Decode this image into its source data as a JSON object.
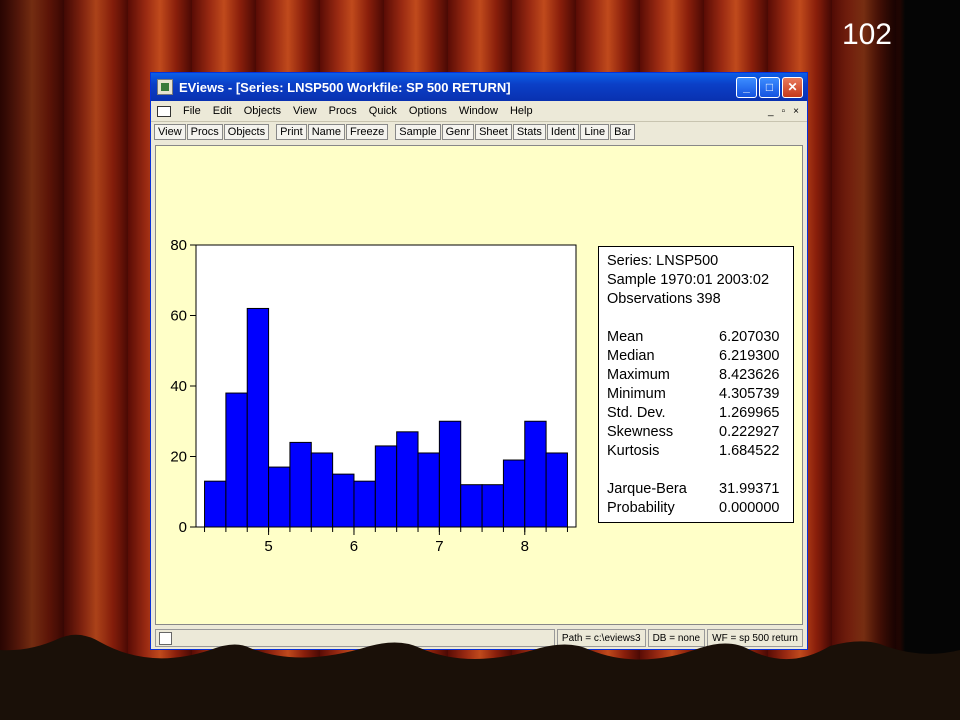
{
  "slide": {
    "number": "102"
  },
  "window": {
    "title": "EViews - [Series: LNSP500   Workfile: SP 500 RETURN]",
    "min_icon": "minimize-icon",
    "max_icon": "maximize-icon",
    "close_icon": "close-icon"
  },
  "menu": {
    "items": [
      "File",
      "Edit",
      "Objects",
      "View",
      "Procs",
      "Quick",
      "Options",
      "Window",
      "Help"
    ],
    "right": [
      "_",
      "▫",
      "×"
    ]
  },
  "toolbar": {
    "group1": [
      "View",
      "Procs",
      "Objects"
    ],
    "group2": [
      "Print",
      "Name",
      "Freeze"
    ],
    "group3": [
      "Sample",
      "Genr",
      "Sheet",
      "Stats",
      "Ident",
      "Line",
      "Bar"
    ]
  },
  "stats": {
    "series": "Series: LNSP500",
    "sample": "Sample 1970:01 2003:02",
    "observations": "Observations 398",
    "rows1": [
      {
        "label": "Mean",
        "value": "6.207030"
      },
      {
        "label": "Median",
        "value": "6.219300"
      },
      {
        "label": "Maximum",
        "value": "8.423626"
      },
      {
        "label": "Minimum",
        "value": "4.305739"
      },
      {
        "label": "Std. Dev.",
        "value": "1.269965"
      },
      {
        "label": "Skewness",
        "value": "0.222927"
      },
      {
        "label": "Kurtosis",
        "value": "1.684522"
      }
    ],
    "rows2": [
      {
        "label": "Jarque-Bera",
        "value": "31.99371"
      },
      {
        "label": "Probability",
        "value": "0.000000"
      }
    ]
  },
  "status": {
    "path": "Path = c:\\eviews3",
    "db": "DB = none",
    "wf": "WF = sp 500 return"
  },
  "colors": {
    "bar_fill": "#0000ff",
    "panel_bg": "#ffffc8"
  },
  "chart_data": {
    "type": "bar",
    "bins": [
      {
        "from": 4.25,
        "to": 4.5,
        "count": 13
      },
      {
        "from": 4.5,
        "to": 4.75,
        "count": 38
      },
      {
        "from": 4.75,
        "to": 5.0,
        "count": 62
      },
      {
        "from": 5.0,
        "to": 5.25,
        "count": 17
      },
      {
        "from": 5.25,
        "to": 5.5,
        "count": 24
      },
      {
        "from": 5.5,
        "to": 5.75,
        "count": 21
      },
      {
        "from": 5.75,
        "to": 6.0,
        "count": 15
      },
      {
        "from": 6.0,
        "to": 6.25,
        "count": 13
      },
      {
        "from": 6.25,
        "to": 6.5,
        "count": 23
      },
      {
        "from": 6.5,
        "to": 6.75,
        "count": 27
      },
      {
        "from": 6.75,
        "to": 7.0,
        "count": 21
      },
      {
        "from": 7.0,
        "to": 7.25,
        "count": 30
      },
      {
        "from": 7.25,
        "to": 7.5,
        "count": 12
      },
      {
        "from": 7.5,
        "to": 7.75,
        "count": 12
      },
      {
        "from": 7.75,
        "to": 8.0,
        "count": 19
      },
      {
        "from": 8.0,
        "to": 8.25,
        "count": 30
      },
      {
        "from": 8.25,
        "to": 8.5,
        "count": 21
      }
    ],
    "xlim": [
      4.15,
      8.6
    ],
    "ylim": [
      0,
      80
    ],
    "xticks": [
      5,
      6,
      7,
      8
    ],
    "yticks": [
      0,
      20,
      40,
      60,
      80
    ],
    "title": "",
    "xlabel": "",
    "ylabel": "",
    "grid": false
  }
}
